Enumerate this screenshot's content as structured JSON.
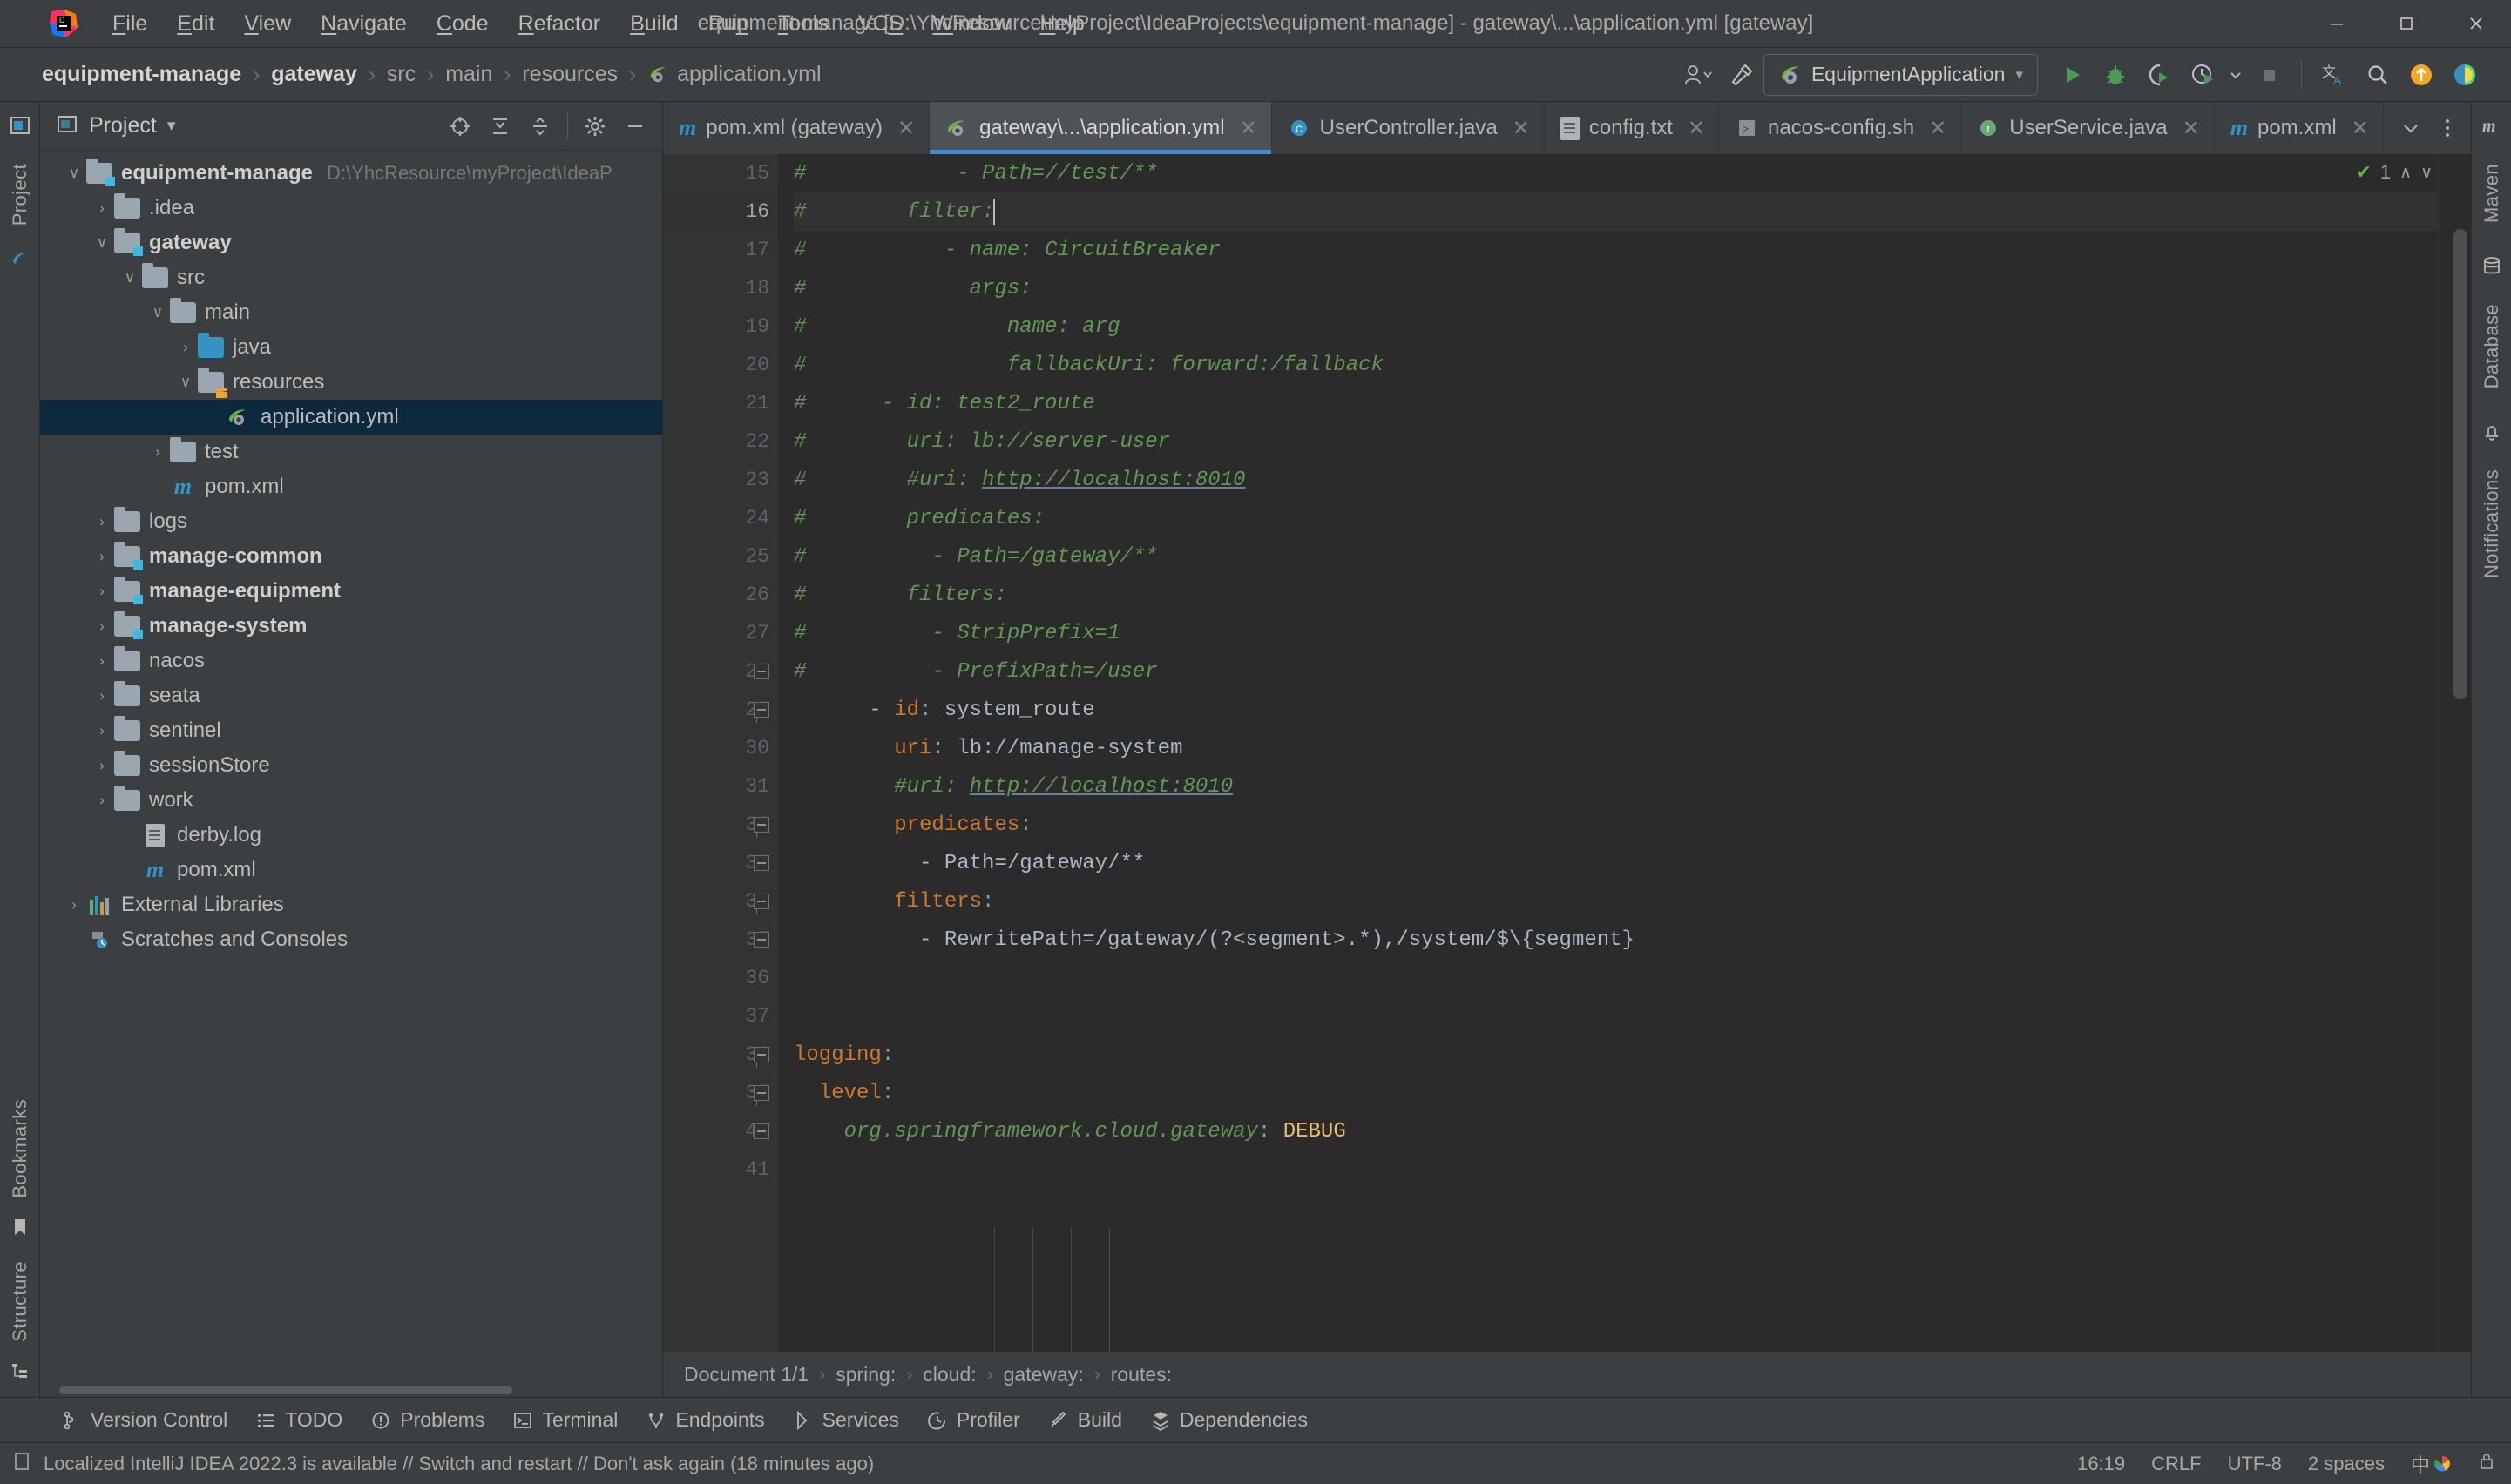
{
  "window": {
    "title": "equipment-manage [D:\\YhcResource\\myProject\\IdeaProjects\\equipment-manage] - gateway\\...\\application.yml [gateway]",
    "minimize": "–",
    "maximize": "❐",
    "close": "✕"
  },
  "menubar": {
    "items": [
      {
        "label": "File",
        "mnemonic": "F"
      },
      {
        "label": "Edit",
        "mnemonic": "E"
      },
      {
        "label": "View",
        "mnemonic": "V"
      },
      {
        "label": "Navigate",
        "mnemonic": "N"
      },
      {
        "label": "Code",
        "mnemonic": "C"
      },
      {
        "label": "Refactor",
        "mnemonic": "R"
      },
      {
        "label": "Build",
        "mnemonic": "B"
      },
      {
        "label": "Run",
        "mnemonic": "n"
      },
      {
        "label": "Tools",
        "mnemonic": "T"
      },
      {
        "label": "VCS",
        "mnemonic": "S"
      },
      {
        "label": "Window",
        "mnemonic": "W"
      },
      {
        "label": "Help",
        "mnemonic": "H"
      }
    ]
  },
  "navbar": {
    "crumbs": [
      {
        "label": "equipment-manage",
        "bold": true
      },
      {
        "label": "gateway",
        "bold": true
      },
      {
        "label": "src",
        "bold": false
      },
      {
        "label": "main",
        "bold": false
      },
      {
        "label": "resources",
        "bold": false
      },
      {
        "label": "application.yml",
        "bold": false,
        "icon": "spring-yaml-icon"
      }
    ],
    "separator": "›",
    "run_config": "EquipmentApplication",
    "run_config_caret": "▾",
    "actions": [
      "run-button",
      "debug-button",
      "run-coverage-button",
      "profiler-button",
      "stop-button",
      "translate-button",
      "search-everywhere-button",
      "updates-button",
      "feedback-button"
    ]
  },
  "left_rail": {
    "project_label": "Project",
    "bookmarks_label": "Bookmarks",
    "structure_label": "Structure"
  },
  "right_rail": {
    "maven_label": "Maven",
    "database_label": "Database",
    "notifications_label": "Notifications"
  },
  "project_panel": {
    "title": "Project",
    "title_caret": "▾",
    "header_icons": [
      "select-opened-file-icon",
      "expand-all-icon",
      "collapse-all-icon",
      "settings-gear-icon",
      "hide-panel-icon"
    ],
    "tree": [
      {
        "label": "equipment-manage",
        "path": "D:\\YhcResource\\myProject\\IdeaP",
        "indent": 0,
        "chev": "∨",
        "icon": "module-folder-icon",
        "bold": true
      },
      {
        "label": ".idea",
        "indent": 1,
        "chev": "›",
        "icon": "folder-icon",
        "bold": false
      },
      {
        "label": "gateway",
        "indent": 1,
        "chev": "∨",
        "icon": "module-folder-icon",
        "bold": true
      },
      {
        "label": "src",
        "indent": 2,
        "chev": "∨",
        "icon": "folder-icon",
        "bold": false
      },
      {
        "label": "main",
        "indent": 3,
        "chev": "∨",
        "icon": "folder-icon",
        "bold": false
      },
      {
        "label": "java",
        "indent": 4,
        "chev": "›",
        "icon": "sources-folder-icon",
        "bold": false
      },
      {
        "label": "resources",
        "indent": 4,
        "chev": "∨",
        "icon": "resources-folder-icon",
        "bold": false
      },
      {
        "label": "application.yml",
        "indent": 5,
        "chev": "",
        "icon": "spring-yaml-icon",
        "bold": false,
        "selected": true
      },
      {
        "label": "test",
        "indent": 3,
        "chev": "›",
        "icon": "folder-icon",
        "bold": false
      },
      {
        "label": "pom.xml",
        "indent": 3,
        "chev": "",
        "icon": "maven-icon",
        "bold": false
      },
      {
        "label": "logs",
        "indent": 1,
        "chev": "›",
        "icon": "folder-icon",
        "bold": false
      },
      {
        "label": "manage-common",
        "indent": 1,
        "chev": "›",
        "icon": "module-folder-icon",
        "bold": true
      },
      {
        "label": "manage-equipment",
        "indent": 1,
        "chev": "›",
        "icon": "module-folder-icon",
        "bold": true
      },
      {
        "label": "manage-system",
        "indent": 1,
        "chev": "›",
        "icon": "module-folder-icon",
        "bold": true
      },
      {
        "label": "nacos",
        "indent": 1,
        "chev": "›",
        "icon": "folder-icon",
        "bold": false
      },
      {
        "label": "seata",
        "indent": 1,
        "chev": "›",
        "icon": "folder-icon",
        "bold": false
      },
      {
        "label": "sentinel",
        "indent": 1,
        "chev": "›",
        "icon": "folder-icon",
        "bold": false
      },
      {
        "label": "sessionStore",
        "indent": 1,
        "chev": "›",
        "icon": "folder-icon",
        "bold": false
      },
      {
        "label": "work",
        "indent": 1,
        "chev": "›",
        "icon": "folder-icon",
        "bold": false
      },
      {
        "label": "derby.log",
        "indent": 2,
        "chev": "",
        "icon": "text-file-icon",
        "bold": false
      },
      {
        "label": "pom.xml",
        "indent": 2,
        "chev": "",
        "icon": "maven-icon",
        "bold": false
      },
      {
        "label": "External Libraries",
        "indent": 0,
        "chev": "›",
        "icon": "libraries-icon",
        "bold": false
      },
      {
        "label": "Scratches and Consoles",
        "indent": 0,
        "chev": "",
        "icon": "scratches-icon",
        "bold": false
      }
    ]
  },
  "editor_tabs": {
    "tabs": [
      {
        "label": "pom.xml (gateway)",
        "icon": "maven-icon",
        "active": false,
        "close": "✕"
      },
      {
        "label": "gateway\\...\\application.yml",
        "icon": "spring-yaml-icon",
        "active": true,
        "close": "✕"
      },
      {
        "label": "UserController.java",
        "icon": "java-class-icon",
        "active": false,
        "close": "✕"
      },
      {
        "label": "config.txt",
        "icon": "text-file-icon",
        "active": false,
        "close": "✕"
      },
      {
        "label": "nacos-config.sh",
        "icon": "shell-script-icon",
        "active": false,
        "close": "✕"
      },
      {
        "label": "UserService.java",
        "icon": "java-interface-icon",
        "active": false,
        "close": "✕"
      },
      {
        "label": "pom.xml",
        "icon": "maven-icon",
        "active": false,
        "close": "✕"
      }
    ],
    "overflow_caret": "∨",
    "more_icon": "⋮"
  },
  "inspection": {
    "status_icon": "✔",
    "count": "1",
    "up_caret": "∧",
    "down_caret": "∨"
  },
  "code": {
    "first_line_number": 15,
    "cursor_line": 16,
    "lines": [
      {
        "n": 15,
        "tokens": [
          {
            "t": "#",
            "c": "hash"
          },
          {
            "t": "            - Path=//test/**",
            "c": "cm"
          }
        ]
      },
      {
        "n": 16,
        "cursor": true,
        "tokens": [
          {
            "t": "#",
            "c": "hash"
          },
          {
            "t": "        filter:",
            "c": "cm"
          }
        ],
        "caret_after": true
      },
      {
        "n": 17,
        "tokens": [
          {
            "t": "#",
            "c": "hash"
          },
          {
            "t": "           - name: CircuitBreaker",
            "c": "cm"
          }
        ]
      },
      {
        "n": 18,
        "tokens": [
          {
            "t": "#",
            "c": "hash"
          },
          {
            "t": "             args:",
            "c": "cm"
          }
        ]
      },
      {
        "n": 19,
        "tokens": [
          {
            "t": "#",
            "c": "hash"
          },
          {
            "t": "                name: arg",
            "c": "cm"
          }
        ]
      },
      {
        "n": 20,
        "tokens": [
          {
            "t": "#",
            "c": "hash"
          },
          {
            "t": "                fallbackUri: forward:/fallback",
            "c": "cm"
          }
        ]
      },
      {
        "n": 21,
        "tokens": [
          {
            "t": "#",
            "c": "hash"
          },
          {
            "t": "      - id: test2_route",
            "c": "cm"
          }
        ]
      },
      {
        "n": 22,
        "tokens": [
          {
            "t": "#",
            "c": "hash"
          },
          {
            "t": "        uri: lb://server-user",
            "c": "cm"
          }
        ]
      },
      {
        "n": 23,
        "tokens": [
          {
            "t": "#",
            "c": "hash"
          },
          {
            "t": "        #uri: ",
            "c": "cm"
          },
          {
            "t": "http://localhost:8010",
            "c": "lnk"
          }
        ]
      },
      {
        "n": 24,
        "tokens": [
          {
            "t": "#",
            "c": "hash"
          },
          {
            "t": "        predicates:",
            "c": "cm"
          }
        ]
      },
      {
        "n": 25,
        "tokens": [
          {
            "t": "#",
            "c": "hash"
          },
          {
            "t": "          - Path=/gateway/**",
            "c": "cm"
          }
        ]
      },
      {
        "n": 26,
        "tokens": [
          {
            "t": "#",
            "c": "hash"
          },
          {
            "t": "        filters:",
            "c": "cm"
          }
        ]
      },
      {
        "n": 27,
        "tokens": [
          {
            "t": "#",
            "c": "hash"
          },
          {
            "t": "          - StripPrefix=1",
            "c": "cm"
          }
        ]
      },
      {
        "n": 28,
        "tokens": [
          {
            "t": "#",
            "c": "hash"
          },
          {
            "t": "          - PrefixPath=/user",
            "c": "cm"
          }
        ],
        "fold": "end"
      },
      {
        "n": 29,
        "tokens": [
          {
            "t": "      - ",
            "c": "val"
          },
          {
            "t": "id",
            "c": "key"
          },
          {
            "t": ":",
            "c": "punc"
          },
          {
            "t": " system_route",
            "c": "val"
          }
        ],
        "fold": "start"
      },
      {
        "n": 30,
        "tokens": [
          {
            "t": "        ",
            "c": "val"
          },
          {
            "t": "uri",
            "c": "key"
          },
          {
            "t": ":",
            "c": "punc"
          },
          {
            "t": " lb://manage-system",
            "c": "val"
          }
        ]
      },
      {
        "n": 31,
        "tokens": [
          {
            "t": "        #uri: ",
            "c": "cm"
          },
          {
            "t": "http://localhost:8010",
            "c": "lnk"
          }
        ]
      },
      {
        "n": 32,
        "tokens": [
          {
            "t": "        ",
            "c": "val"
          },
          {
            "t": "predicates",
            "c": "key"
          },
          {
            "t": ":",
            "c": "punc"
          }
        ],
        "fold": "start"
      },
      {
        "n": 33,
        "tokens": [
          {
            "t": "          - Path=/gateway/**",
            "c": "val"
          }
        ],
        "fold": "mid"
      },
      {
        "n": 34,
        "tokens": [
          {
            "t": "        ",
            "c": "val"
          },
          {
            "t": "filters",
            "c": "key"
          },
          {
            "t": ":",
            "c": "punc"
          }
        ],
        "fold": "start"
      },
      {
        "n": 35,
        "tokens": [
          {
            "t": "          - RewritePath=/gateway/(?<segment>.*),/system/$\\{segment}",
            "c": "val"
          }
        ],
        "fold": "mid"
      },
      {
        "n": 36,
        "tokens": [
          {
            "t": "",
            "c": "val"
          }
        ]
      },
      {
        "n": 37,
        "tokens": [
          {
            "t": "",
            "c": "val"
          }
        ]
      },
      {
        "n": 38,
        "tokens": [
          {
            "t": "logging",
            "c": "key"
          },
          {
            "t": ":",
            "c": "punc"
          }
        ],
        "fold": "start"
      },
      {
        "n": 39,
        "tokens": [
          {
            "t": "  ",
            "c": "val"
          },
          {
            "t": "level",
            "c": "key"
          },
          {
            "t": ":",
            "c": "punc"
          }
        ],
        "fold": "start"
      },
      {
        "n": 40,
        "tokens": [
          {
            "t": "    ",
            "c": "val"
          },
          {
            "t": "org.springframework.cloud.gateway",
            "c": "cm"
          },
          {
            "t": ":",
            "c": "punc"
          },
          {
            "t": " ",
            "c": "val"
          },
          {
            "t": "DEBUG",
            "c": "str"
          }
        ],
        "fold": "mid"
      },
      {
        "n": 41,
        "tokens": [
          {
            "t": "",
            "c": "val"
          }
        ]
      }
    ]
  },
  "editor_breadcrumbs": {
    "items": [
      "Document 1/1",
      "spring:",
      "cloud:",
      "gateway:",
      "routes:"
    ],
    "separator": "›"
  },
  "tool_windows": {
    "items": [
      {
        "label": "Version Control",
        "icon": "branch-icon"
      },
      {
        "label": "TODO",
        "icon": "todo-list-icon"
      },
      {
        "label": "Problems",
        "icon": "problems-icon"
      },
      {
        "label": "Terminal",
        "icon": "terminal-icon"
      },
      {
        "label": "Endpoints",
        "icon": "endpoints-icon"
      },
      {
        "label": "Services",
        "icon": "services-icon"
      },
      {
        "label": "Profiler",
        "icon": "profiler-icon"
      },
      {
        "label": "Build",
        "icon": "build-hammer-icon"
      },
      {
        "label": "Dependencies",
        "icon": "dependencies-icon"
      }
    ]
  },
  "statusbar": {
    "message": "Localized IntelliJ IDEA 2022.3 is available // Switch and restart // Don't ask again (18 minutes ago)",
    "message_icon": "notification-icon",
    "time": "16:19",
    "line_separator": "CRLF",
    "encoding": "UTF-8",
    "indent": "2 spaces",
    "ime": "中",
    "lock_icon": "read-only-icon"
  },
  "colors": {
    "accent_blue": "#4a88c7",
    "ui_bg": "#3c3f41",
    "editor_bg": "#2b2b2b",
    "gutter_bg": "#313335",
    "selection_blue": "#0d293e",
    "comment_green": "#629755",
    "key_orange": "#cc7832",
    "value_grey": "#a9b7c6",
    "string_yellow": "#e8bf6a",
    "run_green": "#499c54"
  }
}
